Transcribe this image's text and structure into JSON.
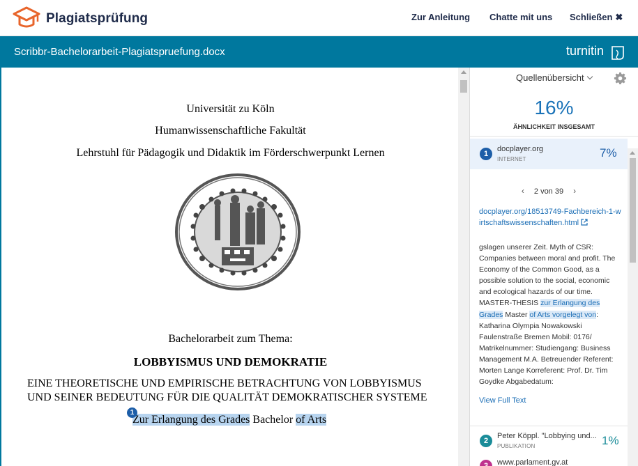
{
  "header": {
    "brand": "Plagiatsprüfung",
    "nav_guide": "Zur Anleitung",
    "nav_chat": "Chatte mit uns",
    "nav_close": "Schließen",
    "close_symbol": "✖"
  },
  "toolbar": {
    "filename": "Scribbr-Bachelorarbeit-Plagiatspruefung.docx",
    "turnitin": "turnitin"
  },
  "document": {
    "lines": [
      "Universität zu Köln",
      "Humanwissenschaftliche Fakultät",
      "Lehrstuhl für Pädagogik und Didaktik im Förderschwerpunkt Lernen"
    ],
    "thesis_intro": "Bachelorarbeit zum Thema:",
    "title": "LOBBYISMUS UND DEMOKRATIE",
    "subtitle_1": "EINE THEORETISCHE UND EMPIRISCHE BETRACHTUNG VON LOBBYISMUS",
    "subtitle_2": "UND SEINER BEDEUTUNG FÜR DIE QUALITÄT DEMOKRATISCHER SYSTEME",
    "degree_hl_1": "Zur Erlangung des Grades",
    "degree_plain": " Bachelor ",
    "degree_hl_2": "of Arts",
    "match_marker": "1"
  },
  "panel": {
    "overview_label": "Quellenübersicht",
    "similarity_percent": "16%",
    "similarity_label": "ÄHNLICHKEIT INSGESAMT",
    "sources": [
      {
        "num": "1",
        "name": "docplayer.org",
        "type": "INTERNET",
        "percent": "7%",
        "color": "#1d5ea8"
      },
      {
        "num": "2",
        "name": "Peter Köppl. \"Lobbying und...",
        "type": "PUBLIKATION",
        "percent": "1%",
        "color": "#1a8c99"
      },
      {
        "num": "3",
        "name": "www.parlament.gv.at",
        "type": "",
        "percent": "",
        "color": "#c0338e"
      }
    ],
    "pager": "2 von 39",
    "link": "docplayer.org/18513749-Fachbereich-1-wirtschaftswissenschaften.html",
    "excerpt_parts": {
      "p1": "gslagen unserer Zeit. Myth of CSR: Companies between moral and profit. The Economy of the Common Good, as a possible solution to the social, economic and ecological hazards of our time. MASTER-THESIS ",
      "m1": "zur Erlangung des Grades",
      "p2": " Master ",
      "m2": "of Arts vorgelegt von",
      "p3": ": Katharina Olympia Nowakowski Faulenstraße Bremen Mobil: 0176/ Matrikelnummer: Studiengang: Business Management M.A. Betreuender Referent: Morten Lange Korreferent: Prof. Dr. Tim Goydke Abgabedatum:"
    },
    "view_full": "View Full Text"
  }
}
